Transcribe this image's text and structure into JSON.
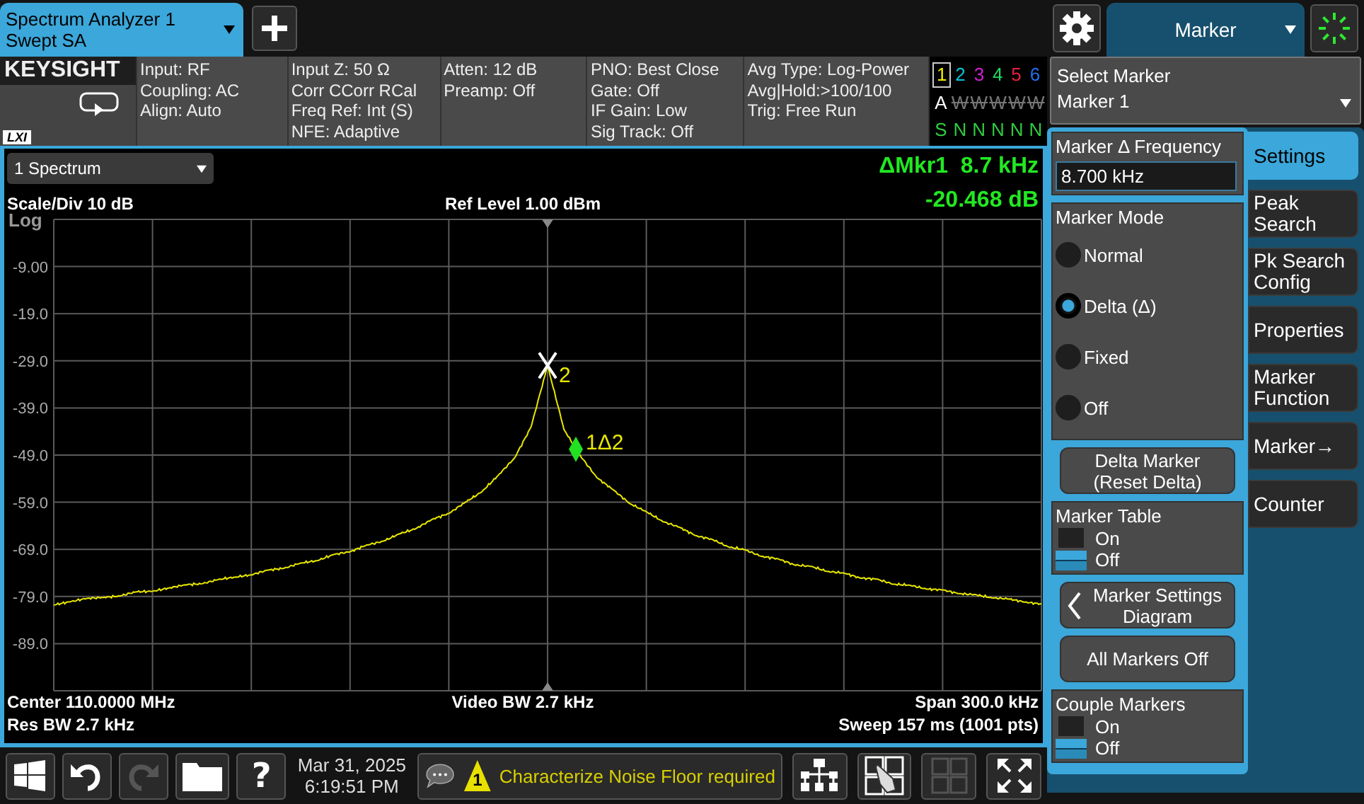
{
  "app_tab": {
    "title": "Spectrum Analyzer 1",
    "subtitle": "Swept SA"
  },
  "menu_tab": {
    "label": "Marker"
  },
  "info_bar": {
    "brand": "KEYSIGHT",
    "lxi": "LXI",
    "columns": [
      [
        "Input: RF",
        "Coupling: AC",
        "Align: Auto"
      ],
      [
        "Input Z: 50 Ω",
        "Corr CCorr RCal",
        "Freq Ref: Int (S)",
        "NFE: Adaptive"
      ],
      [
        "Atten: 12 dB",
        "Preamp: Off"
      ],
      [
        "PNO: Best Close",
        "Gate: Off",
        "IF Gain: Low",
        "Sig Track: Off"
      ],
      [
        "Avg Type: Log-Power",
        "Avg|Hold:>100/100",
        "Trig: Free Run"
      ]
    ]
  },
  "traces": [
    {
      "number": "1",
      "color": "#f0f000",
      "selected": true,
      "type": "A",
      "active": true,
      "detector": "S"
    },
    {
      "number": "2",
      "color": "#00c8d8",
      "selected": false,
      "type": "W",
      "active": false,
      "detector": "N"
    },
    {
      "number": "3",
      "color": "#d020d0",
      "selected": false,
      "type": "W",
      "active": false,
      "detector": "N"
    },
    {
      "number": "4",
      "color": "#20d860",
      "selected": false,
      "type": "W",
      "active": false,
      "detector": "N"
    },
    {
      "number": "5",
      "color": "#e82040",
      "selected": false,
      "type": "W",
      "active": false,
      "detector": "N"
    },
    {
      "number": "6",
      "color": "#2070f0",
      "selected": false,
      "type": "W",
      "active": false,
      "detector": "N"
    }
  ],
  "graph": {
    "window": "1 Spectrum",
    "readout_delta": "ΔMkr1  8.7 kHz",
    "readout_value": "-20.468 dB",
    "scale": "Scale/Div 10 dB",
    "ref_level": "Ref Level 1.00 dBm",
    "scale_type": "Log",
    "chart_data": {
      "type": "line",
      "grid": true,
      "ylim": [
        -99,
        1
      ],
      "yticks": [
        {
          "value": -9,
          "label": "-9.00"
        },
        {
          "value": -19,
          "label": "-19.0"
        },
        {
          "value": -29,
          "label": "-29.0"
        },
        {
          "value": -39,
          "label": "-39.0"
        },
        {
          "value": -49,
          "label": "-49.0"
        },
        {
          "value": -59,
          "label": "-59.0"
        },
        {
          "value": -69,
          "label": "-69.0"
        },
        {
          "value": -79,
          "label": "-79.0"
        },
        {
          "value": -89,
          "label": "-89.0"
        }
      ],
      "categories": [
        null,
        null,
        null,
        null,
        null,
        null,
        null,
        null,
        null,
        null,
        null,
        null,
        null,
        null,
        null,
        null,
        null,
        null,
        null,
        null,
        null,
        null,
        null,
        null,
        null,
        null,
        null,
        null,
        null,
        null,
        null,
        null,
        null,
        null,
        null,
        null,
        null,
        null,
        null,
        null,
        null,
        null,
        null,
        null,
        null,
        null,
        null,
        null,
        null,
        null,
        null,
        null,
        null,
        null,
        null,
        null,
        null,
        null,
        null,
        null,
        null
      ],
      "series": [
        {
          "color": "#e8e800",
          "values": [
            -80.8,
            -80.1,
            -79.4,
            -79.2,
            -78.9,
            -78.0,
            -77.9,
            -77.2,
            -76.5,
            -76.3,
            -75.4,
            -74.9,
            -74.4,
            -73.4,
            -73.0,
            -71.9,
            -71.4,
            -70.1,
            -69.5,
            -68.1,
            -67.3,
            -65.7,
            -64.6,
            -62.6,
            -61.4,
            -59.0,
            -56.8,
            -53.3,
            -49.6,
            -43.0,
            -30.0,
            -43.6,
            -49.2,
            -53.8,
            -56.4,
            -59.3,
            -61.0,
            -63.1,
            -64.3,
            -66.1,
            -66.9,
            -68.5,
            -69.1,
            -70.5,
            -71.0,
            -72.3,
            -72.6,
            -73.7,
            -74.0,
            -75.1,
            -75.3,
            -76.4,
            -76.6,
            -77.4,
            -77.6,
            -78.4,
            -78.6,
            -79.3,
            -79.5,
            -80.2,
            -80.6
          ]
        }
      ]
    },
    "markers": [
      {
        "kind": "reference",
        "label": "2"
      },
      {
        "kind": "delta",
        "label": "1Δ2"
      }
    ],
    "footer": {
      "center": "Center 110.0000 MHz",
      "video_bw": "Video BW 2.7 kHz",
      "span": "Span 300.0 kHz",
      "res_bw": "Res BW 2.7 kHz",
      "sweep": "Sweep 157 ms (1001 pts)"
    }
  },
  "taskbar": {
    "help": "?",
    "date": "Mar 31, 2025",
    "time": "6:19:51 PM",
    "message_count": "1",
    "message": "Characterize Noise Floor required",
    "redo_disabled": true,
    "layout_disabled": true
  },
  "select_marker": {
    "label": "Select Marker",
    "value": "Marker 1"
  },
  "controls": [
    {
      "kind": "field",
      "label": "Marker Δ Frequency",
      "value": "8.700 kHz"
    },
    {
      "kind": "radio_group",
      "label": "Marker Mode",
      "options": [
        {
          "label": "Normal",
          "selected": false
        },
        {
          "label": "Delta (Δ)",
          "selected": true
        },
        {
          "label": "Fixed",
          "selected": false
        },
        {
          "label": "Off",
          "selected": false
        }
      ]
    },
    {
      "kind": "button",
      "lines": [
        "Delta Marker",
        "(Reset Delta)"
      ]
    },
    {
      "kind": "toggle",
      "label": "Marker Table",
      "on_label": "On",
      "off_label": "Off",
      "on": false
    },
    {
      "kind": "chevron_button",
      "lines": [
        "Marker Settings",
        "Diagram"
      ]
    },
    {
      "kind": "button",
      "lines": [
        "All Markers Off"
      ]
    },
    {
      "kind": "toggle",
      "label": "Couple Markers",
      "on_label": "On",
      "off_label": "Off",
      "on": false
    }
  ],
  "tabs": [
    {
      "label": "Settings",
      "selected": true
    },
    {
      "label": "Peak Search",
      "selected": false
    },
    {
      "label": "Pk Search Config",
      "selected": false
    },
    {
      "label": "Properties",
      "selected": false
    },
    {
      "label": "Marker Function",
      "selected": false
    },
    {
      "label": "Marker→",
      "selected": false
    },
    {
      "label": "Counter",
      "selected": false
    }
  ]
}
